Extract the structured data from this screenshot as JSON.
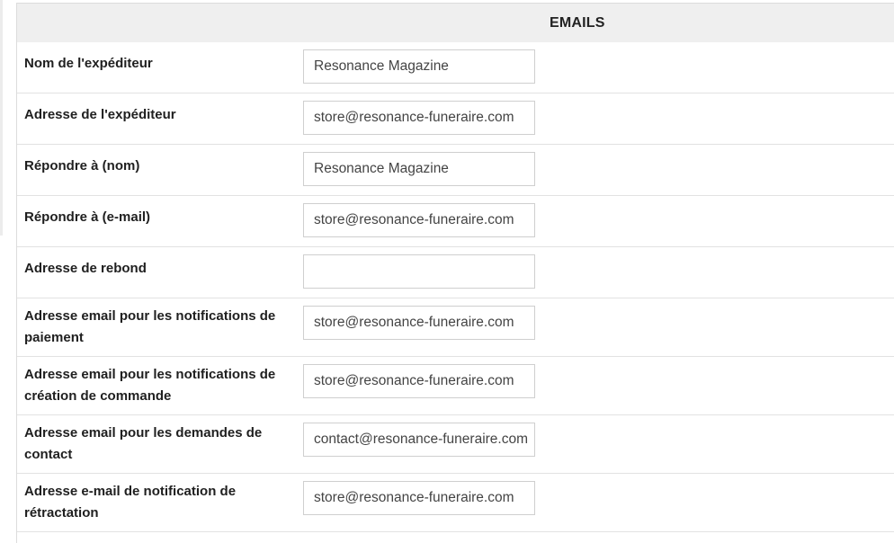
{
  "panel": {
    "title": "EMAILS"
  },
  "fields": [
    {
      "label": "Nom de l'expéditeur",
      "value": "Resonance Magazine"
    },
    {
      "label": "Adresse de l'expéditeur",
      "value": "store@resonance-funeraire.com"
    },
    {
      "label": "Répondre à (nom)",
      "value": "Resonance Magazine"
    },
    {
      "label": "Répondre à (e-mail)",
      "value": "store@resonance-funeraire.com"
    },
    {
      "label": "Adresse de rebond",
      "value": ""
    },
    {
      "label": "Adresse email pour les notifications de paiement",
      "value": "store@resonance-funeraire.com"
    },
    {
      "label": "Adresse email pour les notifications de création de commande",
      "value": "store@resonance-funeraire.com"
    },
    {
      "label": "Adresse email pour les demandes de contact",
      "value": "contact@resonance-funeraire.com"
    },
    {
      "label": "Adresse e-mail de notification de rétractation",
      "value": "store@resonance-funeraire.com"
    }
  ]
}
